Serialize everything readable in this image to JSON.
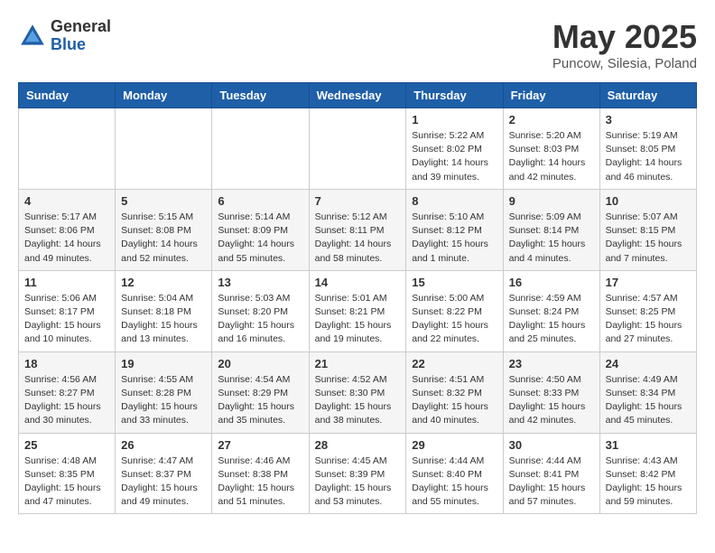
{
  "logo": {
    "general": "General",
    "blue": "Blue"
  },
  "title": "May 2025",
  "location": "Puncow, Silesia, Poland",
  "days_of_week": [
    "Sunday",
    "Monday",
    "Tuesday",
    "Wednesday",
    "Thursday",
    "Friday",
    "Saturday"
  ],
  "weeks": [
    [
      {
        "day": "",
        "info": ""
      },
      {
        "day": "",
        "info": ""
      },
      {
        "day": "",
        "info": ""
      },
      {
        "day": "",
        "info": ""
      },
      {
        "day": "1",
        "info": "Sunrise: 5:22 AM\nSunset: 8:02 PM\nDaylight: 14 hours\nand 39 minutes."
      },
      {
        "day": "2",
        "info": "Sunrise: 5:20 AM\nSunset: 8:03 PM\nDaylight: 14 hours\nand 42 minutes."
      },
      {
        "day": "3",
        "info": "Sunrise: 5:19 AM\nSunset: 8:05 PM\nDaylight: 14 hours\nand 46 minutes."
      }
    ],
    [
      {
        "day": "4",
        "info": "Sunrise: 5:17 AM\nSunset: 8:06 PM\nDaylight: 14 hours\nand 49 minutes."
      },
      {
        "day": "5",
        "info": "Sunrise: 5:15 AM\nSunset: 8:08 PM\nDaylight: 14 hours\nand 52 minutes."
      },
      {
        "day": "6",
        "info": "Sunrise: 5:14 AM\nSunset: 8:09 PM\nDaylight: 14 hours\nand 55 minutes."
      },
      {
        "day": "7",
        "info": "Sunrise: 5:12 AM\nSunset: 8:11 PM\nDaylight: 14 hours\nand 58 minutes."
      },
      {
        "day": "8",
        "info": "Sunrise: 5:10 AM\nSunset: 8:12 PM\nDaylight: 15 hours\nand 1 minute."
      },
      {
        "day": "9",
        "info": "Sunrise: 5:09 AM\nSunset: 8:14 PM\nDaylight: 15 hours\nand 4 minutes."
      },
      {
        "day": "10",
        "info": "Sunrise: 5:07 AM\nSunset: 8:15 PM\nDaylight: 15 hours\nand 7 minutes."
      }
    ],
    [
      {
        "day": "11",
        "info": "Sunrise: 5:06 AM\nSunset: 8:17 PM\nDaylight: 15 hours\nand 10 minutes."
      },
      {
        "day": "12",
        "info": "Sunrise: 5:04 AM\nSunset: 8:18 PM\nDaylight: 15 hours\nand 13 minutes."
      },
      {
        "day": "13",
        "info": "Sunrise: 5:03 AM\nSunset: 8:20 PM\nDaylight: 15 hours\nand 16 minutes."
      },
      {
        "day": "14",
        "info": "Sunrise: 5:01 AM\nSunset: 8:21 PM\nDaylight: 15 hours\nand 19 minutes."
      },
      {
        "day": "15",
        "info": "Sunrise: 5:00 AM\nSunset: 8:22 PM\nDaylight: 15 hours\nand 22 minutes."
      },
      {
        "day": "16",
        "info": "Sunrise: 4:59 AM\nSunset: 8:24 PM\nDaylight: 15 hours\nand 25 minutes."
      },
      {
        "day": "17",
        "info": "Sunrise: 4:57 AM\nSunset: 8:25 PM\nDaylight: 15 hours\nand 27 minutes."
      }
    ],
    [
      {
        "day": "18",
        "info": "Sunrise: 4:56 AM\nSunset: 8:27 PM\nDaylight: 15 hours\nand 30 minutes."
      },
      {
        "day": "19",
        "info": "Sunrise: 4:55 AM\nSunset: 8:28 PM\nDaylight: 15 hours\nand 33 minutes."
      },
      {
        "day": "20",
        "info": "Sunrise: 4:54 AM\nSunset: 8:29 PM\nDaylight: 15 hours\nand 35 minutes."
      },
      {
        "day": "21",
        "info": "Sunrise: 4:52 AM\nSunset: 8:30 PM\nDaylight: 15 hours\nand 38 minutes."
      },
      {
        "day": "22",
        "info": "Sunrise: 4:51 AM\nSunset: 8:32 PM\nDaylight: 15 hours\nand 40 minutes."
      },
      {
        "day": "23",
        "info": "Sunrise: 4:50 AM\nSunset: 8:33 PM\nDaylight: 15 hours\nand 42 minutes."
      },
      {
        "day": "24",
        "info": "Sunrise: 4:49 AM\nSunset: 8:34 PM\nDaylight: 15 hours\nand 45 minutes."
      }
    ],
    [
      {
        "day": "25",
        "info": "Sunrise: 4:48 AM\nSunset: 8:35 PM\nDaylight: 15 hours\nand 47 minutes."
      },
      {
        "day": "26",
        "info": "Sunrise: 4:47 AM\nSunset: 8:37 PM\nDaylight: 15 hours\nand 49 minutes."
      },
      {
        "day": "27",
        "info": "Sunrise: 4:46 AM\nSunset: 8:38 PM\nDaylight: 15 hours\nand 51 minutes."
      },
      {
        "day": "28",
        "info": "Sunrise: 4:45 AM\nSunset: 8:39 PM\nDaylight: 15 hours\nand 53 minutes."
      },
      {
        "day": "29",
        "info": "Sunrise: 4:44 AM\nSunset: 8:40 PM\nDaylight: 15 hours\nand 55 minutes."
      },
      {
        "day": "30",
        "info": "Sunrise: 4:44 AM\nSunset: 8:41 PM\nDaylight: 15 hours\nand 57 minutes."
      },
      {
        "day": "31",
        "info": "Sunrise: 4:43 AM\nSunset: 8:42 PM\nDaylight: 15 hours\nand 59 minutes."
      }
    ]
  ]
}
